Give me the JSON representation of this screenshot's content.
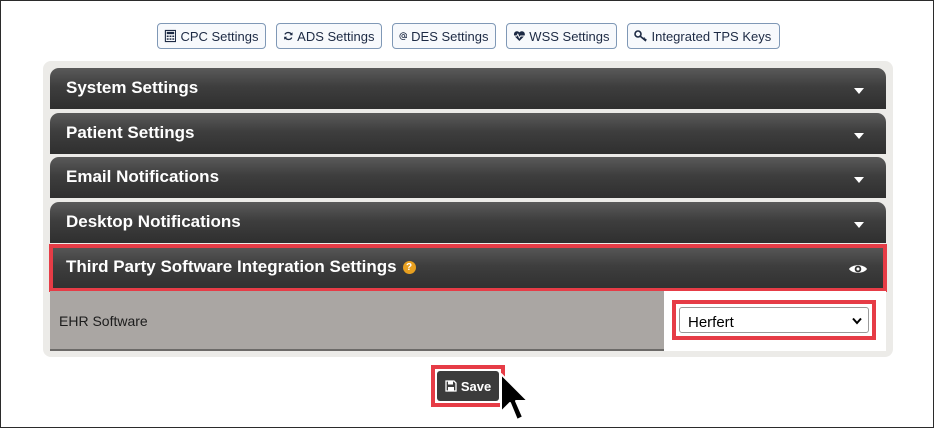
{
  "toolbar": {
    "buttons": [
      {
        "label": "CPC Settings",
        "icon": "calculator-icon"
      },
      {
        "label": "ADS Settings",
        "icon": "refresh-icon"
      },
      {
        "label": "DES Settings",
        "icon": "at-icon"
      },
      {
        "label": "WSS Settings",
        "icon": "heartbeat-icon"
      },
      {
        "label": "Integrated TPS Keys",
        "icon": "key-icon"
      }
    ]
  },
  "accordion": {
    "sections": [
      {
        "label": "System Settings"
      },
      {
        "label": "Patient Settings"
      },
      {
        "label": "Email Notifications"
      },
      {
        "label": "Desktop Notifications"
      },
      {
        "label": "Third Party Software Integration Settings"
      }
    ]
  },
  "ehr": {
    "label": "EHR Software",
    "selected": "Herfert"
  },
  "save": {
    "label": "Save"
  },
  "colors": {
    "highlight": "#e63c46",
    "header_dark": "#333333",
    "help_badge": "#e8a020"
  }
}
